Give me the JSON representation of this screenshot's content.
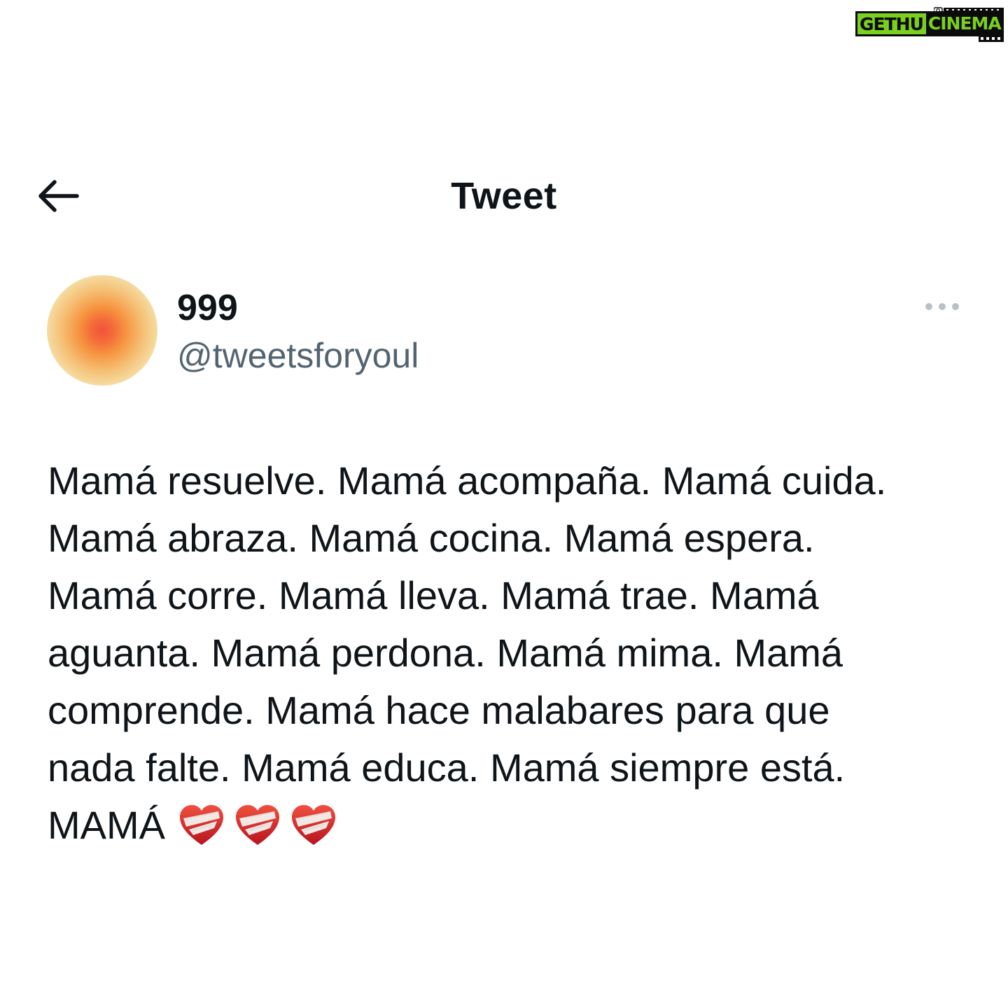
{
  "watermark": {
    "text_left": "GETHU",
    "text_right": "CINEMA",
    "accent_color": "#7bcf1e",
    "icon": "camera-icon"
  },
  "header": {
    "title": "Tweet",
    "back_icon": "arrow-left-icon"
  },
  "tweet": {
    "author": {
      "display_name": "999",
      "handle": "@tweetsforyoul",
      "avatar": "gradient-avatar"
    },
    "more_icon": "more-horizontal-icon",
    "lines": [
      "Mamá resuelve. Mamá acompaña. Mamá cuida.",
      "Mamá abraza. Mamá cocina. Mamá espera.",
      "Mamá corre. Mamá lleva. Mamá trae. Mamá",
      "aguanta. Mamá perdona. Mamá mima. Mamá",
      "comprende. Mamá hace malabares para que",
      "nada falte. Mamá educa. Mamá siempre está.",
      "MAMÁ"
    ],
    "emoji": [
      "mending-heart-emoji",
      "mending-heart-emoji",
      "mending-heart-emoji"
    ]
  },
  "colors": {
    "text": "#0f1419",
    "secondary_text": "#536471",
    "heart": "#d7263d"
  }
}
